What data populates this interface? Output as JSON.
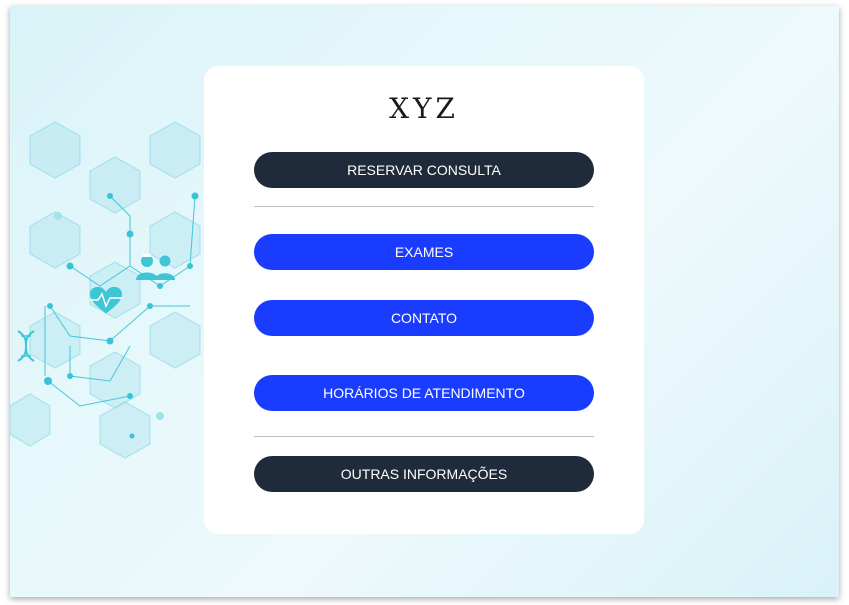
{
  "card": {
    "title": "XYZ",
    "buttons": {
      "reservar": "RESERVAR CONSULTA",
      "exames": "EXAMES",
      "contato": "CONTATO",
      "horarios": "HORÁRIOS DE ATENDIMENTO",
      "outras": "OUTRAS INFORMAÇÕES"
    }
  },
  "colors": {
    "dark_button": "#1f2a3b",
    "blue_button": "#1a3cff",
    "background": "#e6f8fb"
  },
  "icons": [
    "dna-icon",
    "heart-pulse-icon",
    "doctors-icon"
  ]
}
